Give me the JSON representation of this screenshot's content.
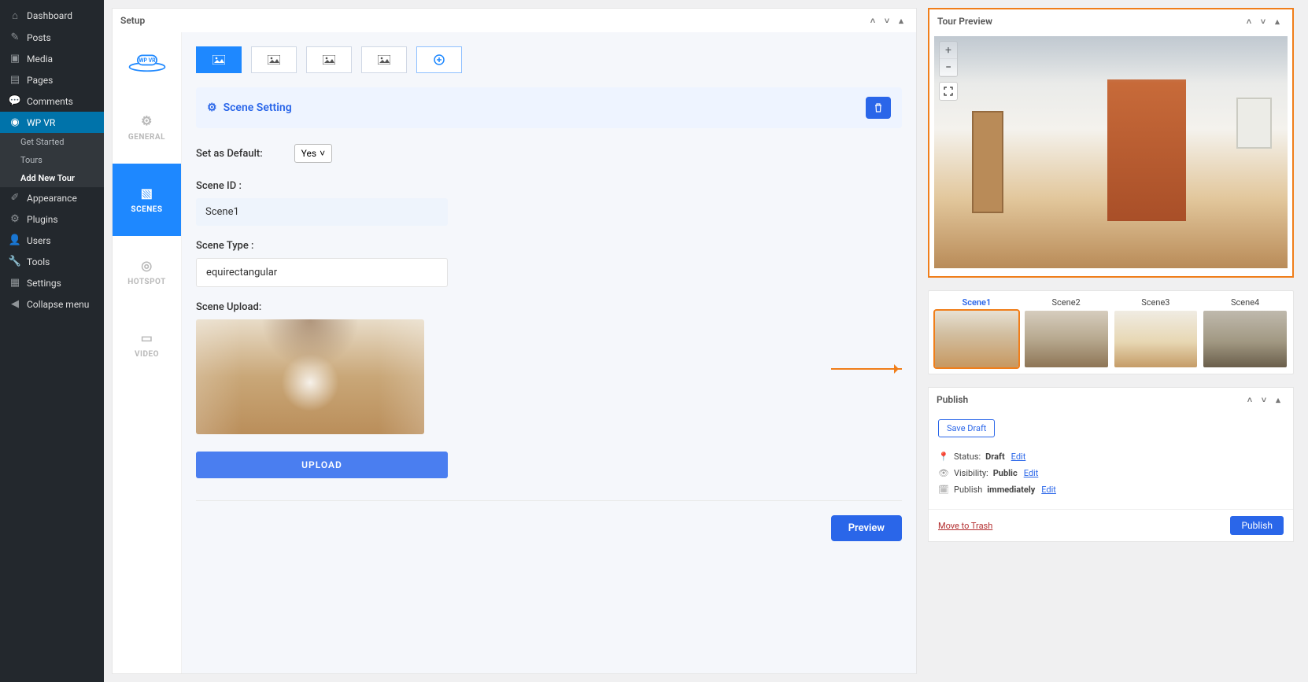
{
  "sidebar": {
    "dashboard": "Dashboard",
    "posts": "Posts",
    "media": "Media",
    "pages": "Pages",
    "comments": "Comments",
    "wpvr": "WP VR",
    "get_started": "Get Started",
    "tours": "Tours",
    "add_new_tour": "Add New Tour",
    "appearance": "Appearance",
    "plugins": "Plugins",
    "users": "Users",
    "tools": "Tools",
    "settings": "Settings",
    "collapse": "Collapse menu"
  },
  "setup": {
    "title": "Setup",
    "left_tabs": {
      "general": "GENERAL",
      "scenes": "SCENES",
      "hotspot": "HOTSPOT",
      "video": "VIDEO"
    },
    "scene_setting": "Scene Setting",
    "set_default": "Set as Default:",
    "set_default_value": "Yes",
    "scene_id_label": "Scene ID :",
    "scene_id_value": "Scene1",
    "scene_type_label": "Scene Type :",
    "scene_type_value": "equirectangular",
    "scene_upload_label": "Scene Upload:",
    "upload_btn": "UPLOAD",
    "preview_btn": "Preview"
  },
  "tour_preview": {
    "title": "Tour Preview",
    "thumbs": [
      "Scene1",
      "Scene2",
      "Scene3",
      "Scene4"
    ]
  },
  "publish": {
    "title": "Publish",
    "save_draft": "Save Draft",
    "status_label": "Status:",
    "status_value": "Draft",
    "edit": "Edit",
    "visibility_label": "Visibility:",
    "visibility_value": "Public",
    "schedule_label": "Publish",
    "schedule_value": "immediately",
    "trash": "Move to Trash",
    "publish_btn": "Publish"
  }
}
